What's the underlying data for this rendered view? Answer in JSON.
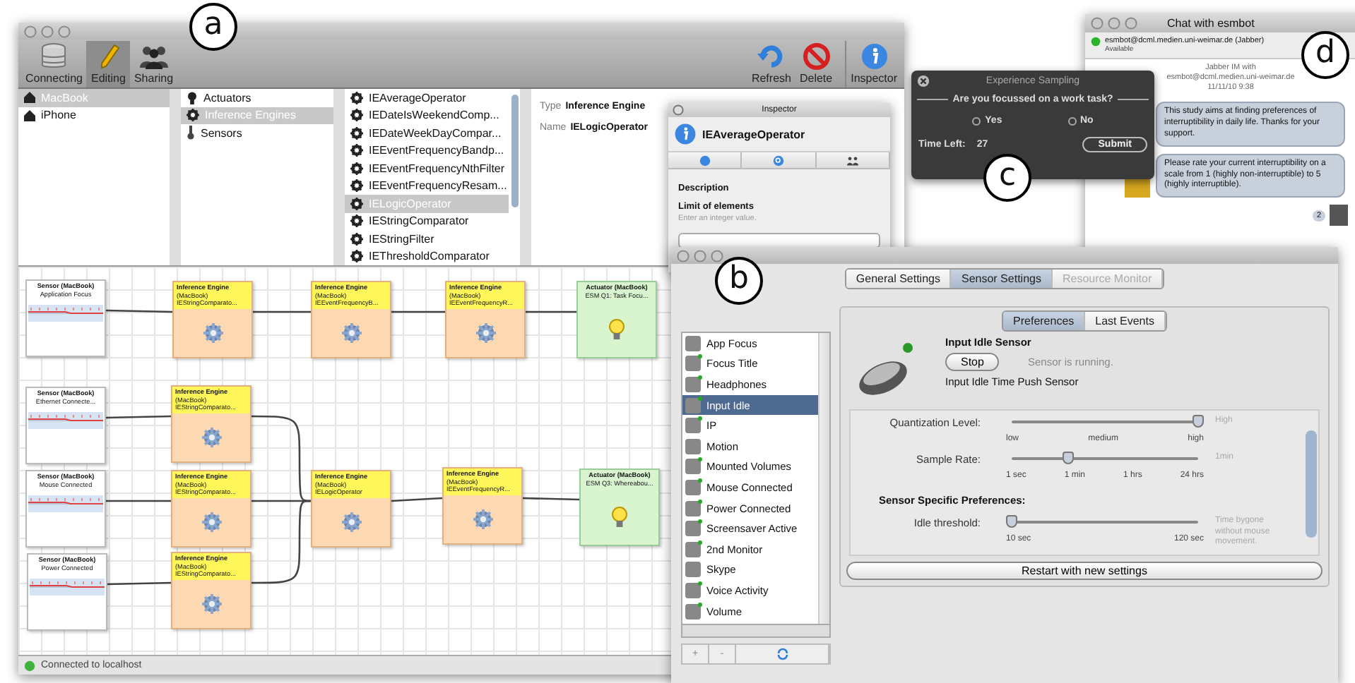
{
  "figure_labels": [
    "a",
    "b",
    "c",
    "d"
  ],
  "editor_window": {
    "toolbar_left": [
      {
        "label": "Connecting",
        "selected": false
      },
      {
        "label": "Editing",
        "selected": true
      },
      {
        "label": "Sharing",
        "selected": false
      }
    ],
    "toolbar_right": [
      {
        "kind": "refresh",
        "label": "Refresh"
      },
      {
        "kind": "delete",
        "label": "Delete"
      },
      {
        "kind": "info",
        "label": "Inspector"
      }
    ],
    "devices": [
      {
        "label": "MacBook",
        "selected": true
      },
      {
        "label": "iPhone",
        "selected": false
      }
    ],
    "categories": [
      {
        "kind": "actuator",
        "label": "Actuators",
        "selected": false
      },
      {
        "kind": "engine",
        "label": "Inference Engines",
        "selected": true
      },
      {
        "kind": "sensor",
        "label": "Sensors",
        "selected": false
      }
    ],
    "components": [
      {
        "label": "IEAverageOperator",
        "selected": false
      },
      {
        "label": "IEDateIsWeekendComp...",
        "selected": false
      },
      {
        "label": "IEDateWeekDayCompar...",
        "selected": false
      },
      {
        "label": "IEEventFrequencyBandp...",
        "selected": false
      },
      {
        "label": "IEEventFrequencyNthFilter",
        "selected": false
      },
      {
        "label": "IEEventFrequencyResam...",
        "selected": false
      },
      {
        "label": "IELogicOperator",
        "selected": true
      },
      {
        "label": "IEStringComparator",
        "selected": false
      },
      {
        "label": "IEStringFilter",
        "selected": false
      },
      {
        "label": "IEThresholdComparator",
        "selected": false
      }
    ],
    "properties": [
      {
        "key": "Type",
        "value": "Inference Engine"
      },
      {
        "key": "Name",
        "value": "IELogicOperator"
      }
    ],
    "nodes": [
      {
        "kind": "sensor",
        "title": "Sensor (MacBook)",
        "lines": [
          "Application Focus"
        ]
      },
      {
        "kind": "engine",
        "title": "Inference Engine",
        "lines": [
          "(MacBook)",
          "IEStringComparato..."
        ]
      },
      {
        "kind": "engine",
        "title": "Inference Engine",
        "lines": [
          "(MacBook)",
          "IEEventFrequencyB..."
        ]
      },
      {
        "kind": "engine",
        "title": "Inference Engine",
        "lines": [
          "(MacBook)",
          "IEEventFrequencyR..."
        ]
      },
      {
        "kind": "actuator",
        "title": "Actuator (MacBook)",
        "lines": [
          "ESM Q1: Task Focu..."
        ]
      },
      {
        "kind": "sensor",
        "title": "Sensor (MacBook)",
        "lines": [
          "Ethernet Connecte..."
        ]
      },
      {
        "kind": "engine",
        "title": "Inference Engine",
        "lines": [
          "(MacBook)",
          "IEStringComparato..."
        ]
      },
      {
        "kind": "sensor",
        "title": "Sensor (MacBook)",
        "lines": [
          "Mouse Connected"
        ]
      },
      {
        "kind": "engine",
        "title": "Inference Engine",
        "lines": [
          "(MacBook)",
          "IEStringComparato..."
        ]
      },
      {
        "kind": "engine",
        "title": "Inference Engine",
        "lines": [
          "(MacBook)",
          "IELogicOperator"
        ]
      },
      {
        "kind": "engine",
        "title": "Inference Engine",
        "lines": [
          "(MacBook)",
          "IEEventFrequencyR..."
        ]
      },
      {
        "kind": "actuator",
        "title": "Actuator (MacBook)",
        "lines": [
          "ESM Q3: Whereabou..."
        ]
      },
      {
        "kind": "sensor",
        "title": "Sensor (MacBook)",
        "lines": [
          "Power Connected"
        ]
      },
      {
        "kind": "engine",
        "title": "Inference Engine",
        "lines": [
          "(MacBook)",
          "IEStringComparato..."
        ]
      }
    ],
    "status": "Connected to localhost"
  },
  "inspector": {
    "title": "Inspector",
    "component": "IEAverageOperator",
    "tabs": [
      {
        "kind": "info"
      },
      {
        "kind": "search"
      },
      {
        "kind": "people"
      }
    ],
    "description_label": "Description",
    "field_label": "Limit of elements",
    "hint": "Enter an integer value."
  },
  "sampling_dialog": {
    "title": "Experience Sampling",
    "question": "Are you focussed on a work task?",
    "options": [
      {
        "label": "Yes",
        "selected": false
      },
      {
        "label": "No",
        "selected": false
      }
    ],
    "time_label": "Time Left:",
    "time_value": "27",
    "submit": "Submit"
  },
  "chat_window": {
    "title": "Chat with esmbot",
    "contact": "esmbot@dcml.medien.uni-weimar.de (Jabber)",
    "presence": "Available",
    "header": "Jabber IM with esmbot@dcml.medien.uni-weimar.de  11/11/10 9:38",
    "messages": [
      "This study aims at finding preferences of interruptibility in daily life. Thanks for your support.",
      "Please rate your current interruptibility on a scale from 1 (highly non-interruptible) to 5 (highly interruptible)."
    ],
    "badge": "2"
  },
  "settings_window": {
    "tabs": [
      {
        "label": "General Settings",
        "selected": false,
        "disabled": false
      },
      {
        "label": "Sensor Settings",
        "selected": true,
        "disabled": false
      },
      {
        "label": "Resource Monitor",
        "selected": false,
        "disabled": true
      }
    ],
    "sensors": [
      {
        "label": "App Focus",
        "active": false,
        "selected": false
      },
      {
        "label": "Focus Title",
        "active": true,
        "selected": false
      },
      {
        "label": "Headphones",
        "active": true,
        "selected": false
      },
      {
        "label": "Input Idle",
        "active": true,
        "selected": true
      },
      {
        "label": "IP",
        "active": true,
        "selected": false
      },
      {
        "label": "Motion",
        "active": false,
        "selected": false
      },
      {
        "label": "Mounted Volumes",
        "active": true,
        "selected": false
      },
      {
        "label": "Mouse Connected",
        "active": true,
        "selected": false
      },
      {
        "label": "Power Connected",
        "active": true,
        "selected": false
      },
      {
        "label": "Screensaver Active",
        "active": true,
        "selected": false
      },
      {
        "label": "2nd Monitor",
        "active": true,
        "selected": false
      },
      {
        "label": "Skype",
        "active": false,
        "selected": false
      },
      {
        "label": "Voice Activity",
        "active": true,
        "selected": false
      },
      {
        "label": "Volume",
        "active": true,
        "selected": false
      }
    ],
    "list_buttons": [
      {
        "kind": "add",
        "label": "+"
      },
      {
        "kind": "remove",
        "label": "-"
      },
      {
        "kind": "refresh"
      }
    ],
    "subtabs": [
      {
        "label": "Preferences",
        "selected": true
      },
      {
        "label": "Last Events",
        "selected": false
      }
    ],
    "sensor_name": "Input Idle Sensor",
    "running": true,
    "stop_button": "Stop",
    "sensor_status": "Sensor is running.",
    "sensor_type": "Input Idle Time Push Sensor",
    "sliders": [
      {
        "label": "Quantization Level:",
        "level": 1,
        "ticks": [
          "low",
          "medium",
          "high"
        ],
        "reading": "High"
      },
      {
        "label": "Sample Rate:",
        "level": 0.3,
        "ticks": [
          "1 sec",
          "1 min",
          "1 hrs",
          "24 hrs"
        ],
        "reading": "1min"
      }
    ],
    "specific_heading": "Sensor Specific Preferences:",
    "specific_sliders": [
      {
        "label": "Idle threshold:",
        "level": 0,
        "ticks": [
          "10 sec",
          "120 sec"
        ],
        "reading": "Time bygone without mouse movement."
      }
    ],
    "restart_button": "Restart with new settings"
  }
}
